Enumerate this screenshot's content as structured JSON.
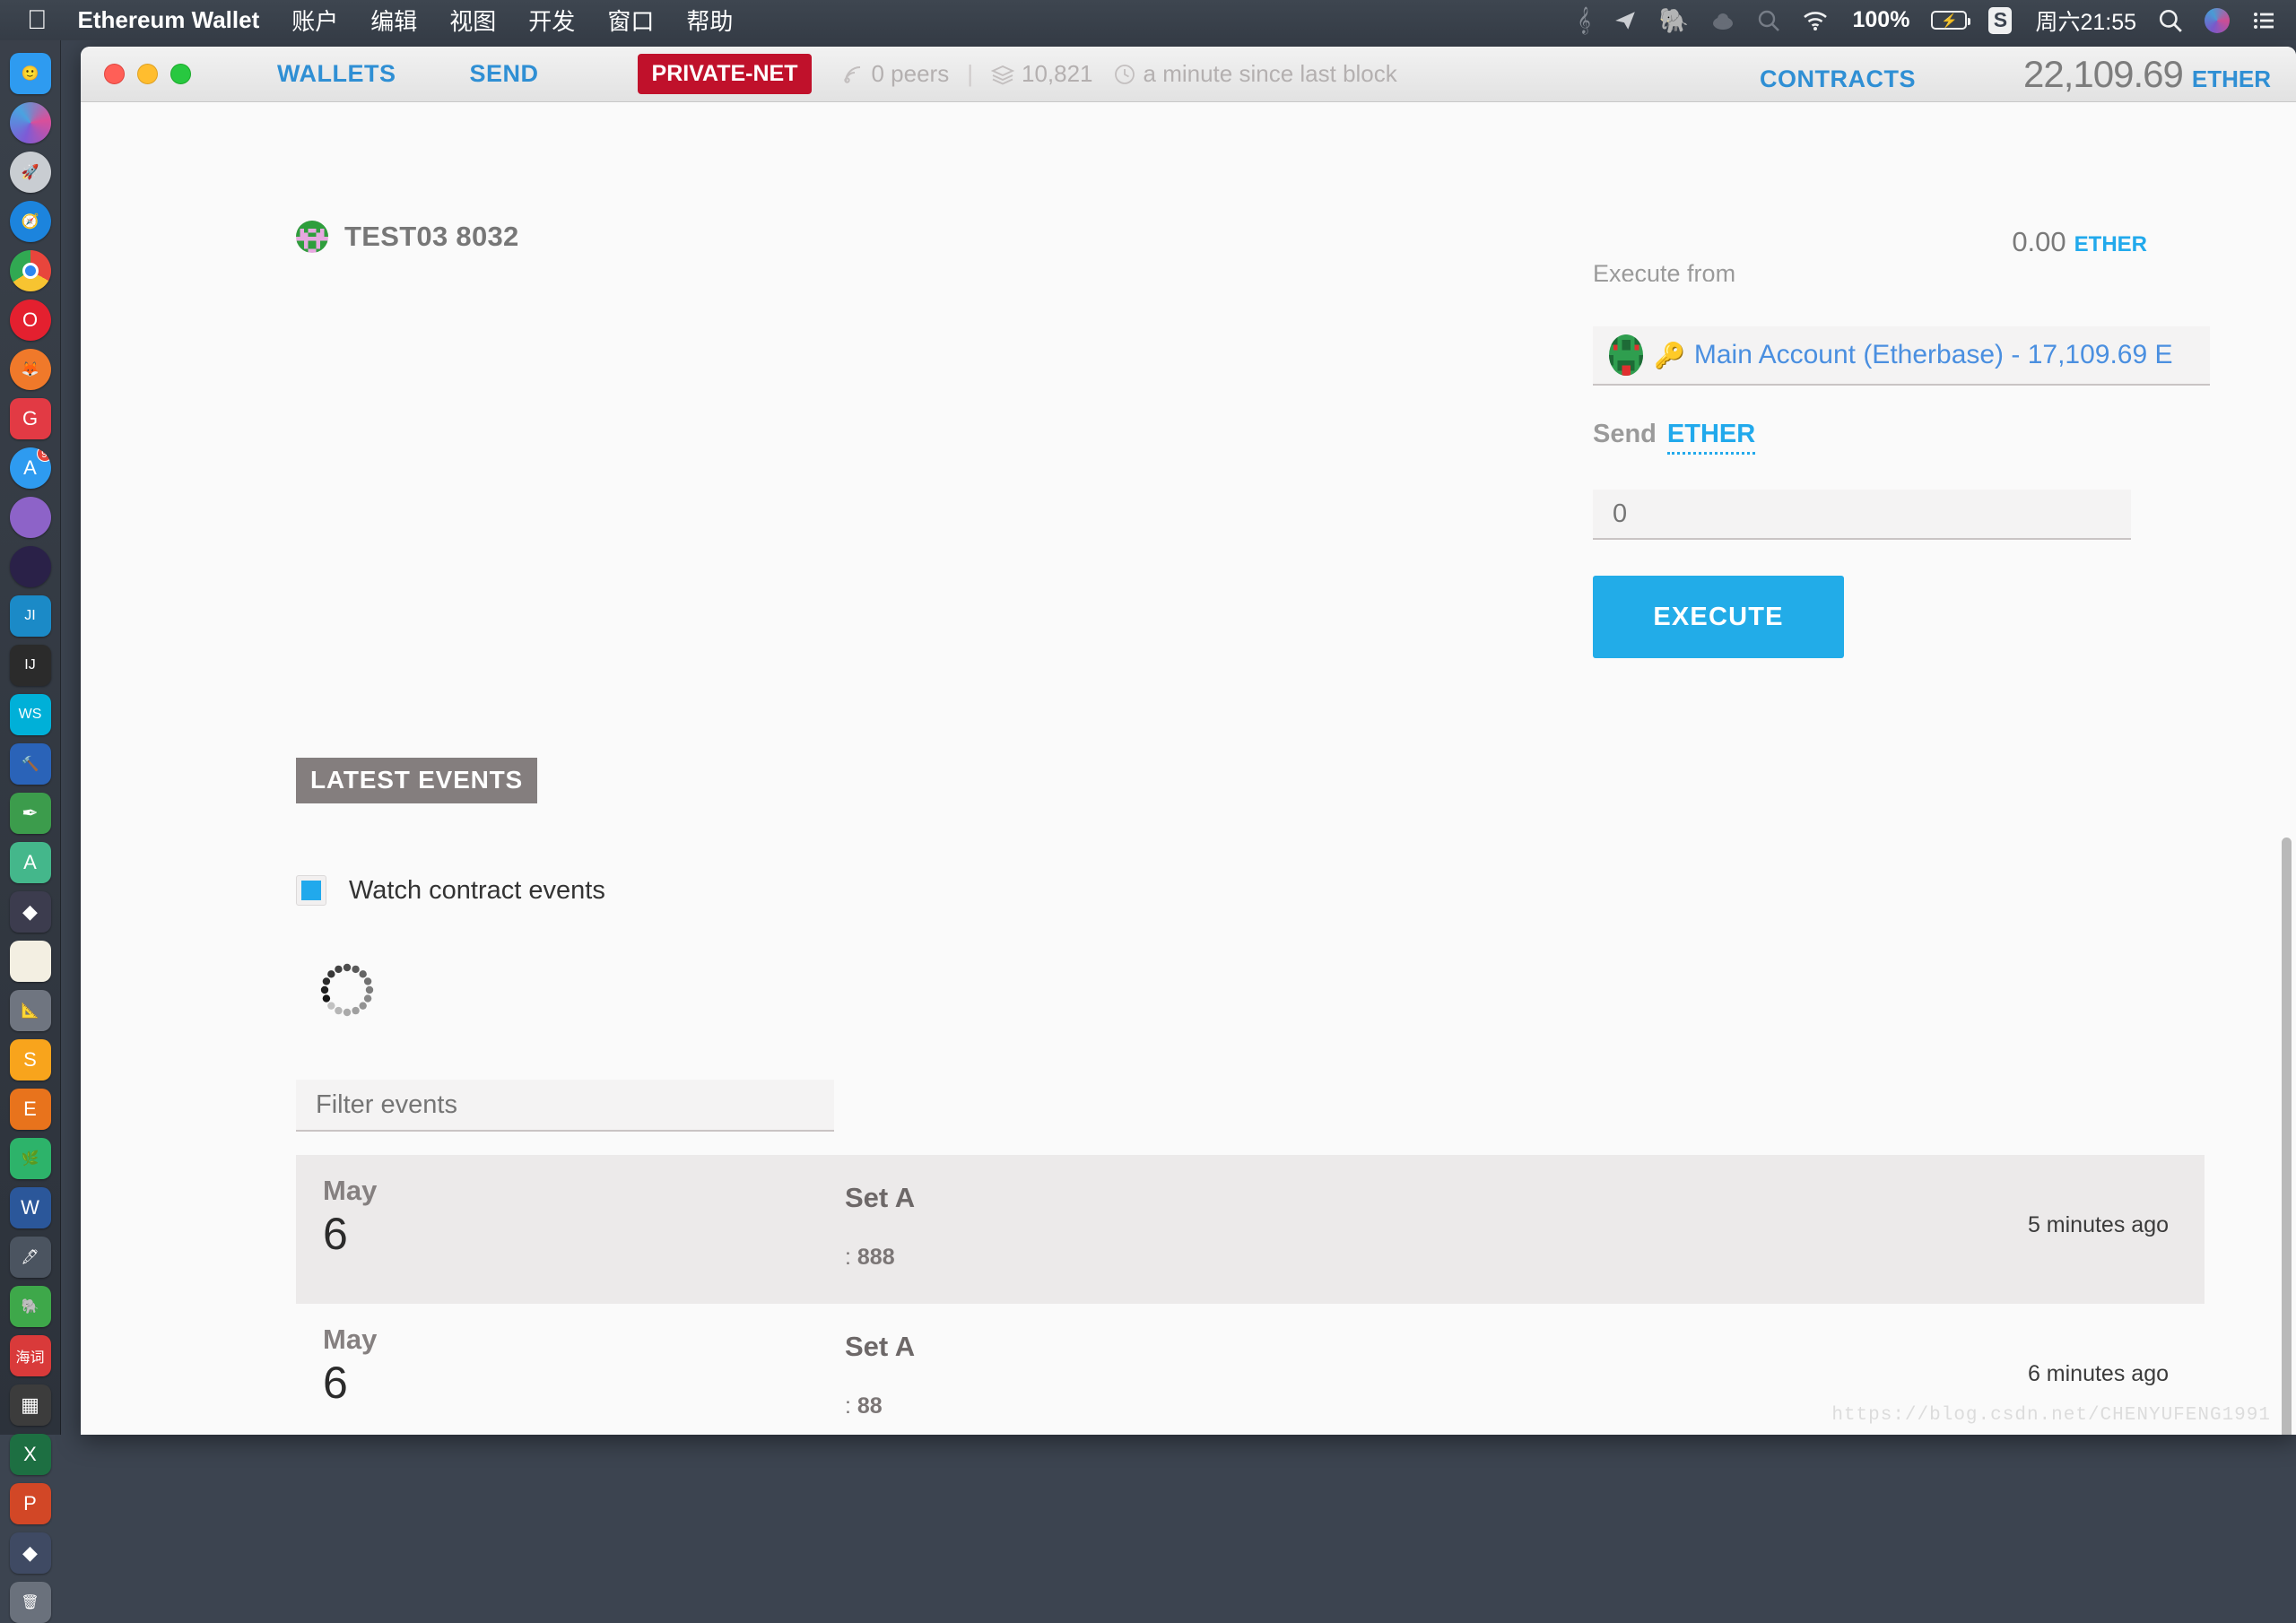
{
  "menubar": {
    "apple_icon": "apple-icon",
    "items": [
      {
        "label": "Ethereum Wallet",
        "bold": true
      },
      {
        "label": "账户",
        "bold": false
      },
      {
        "label": "编辑",
        "bold": false
      },
      {
        "label": "视图",
        "bold": false
      },
      {
        "label": "开发",
        "bold": false
      },
      {
        "label": "窗口",
        "bold": false
      },
      {
        "label": "帮助",
        "bold": false
      }
    ],
    "status_icons": [
      "grammarly-icon",
      "telegram-icon",
      "evernote-icon",
      "cloud-icon",
      "alfred-icon",
      "wifi-icon"
    ],
    "battery_percent": "100%",
    "battery_icon": "battery-charging-icon",
    "sogou_icon": "sogou-input-icon",
    "clock": "周六21:55",
    "search_icon": "spotlight-search-icon",
    "siri_icon": "siri-icon",
    "control_center_icon": "notification-center-icon"
  },
  "dock": {
    "items": [
      {
        "name": "finder",
        "glyph": "🙂",
        "bg": "#2e9bf0",
        "running": true,
        "round": false
      },
      {
        "name": "siri",
        "glyph": "",
        "bg": "siri",
        "running": false,
        "round": true
      },
      {
        "name": "launchpad",
        "glyph": "🚀",
        "bg": "#c9cdd2",
        "running": false,
        "round": true
      },
      {
        "name": "safari",
        "glyph": "🧭",
        "bg": "#1c84dd",
        "running": false,
        "round": true
      },
      {
        "name": "chrome",
        "glyph": "",
        "bg": "chrome",
        "running": true,
        "round": true
      },
      {
        "name": "opera",
        "glyph": "O",
        "bg": "#e4202f",
        "running": false,
        "round": true
      },
      {
        "name": "firefox",
        "glyph": "🦊",
        "bg": "#f0792a",
        "running": false,
        "round": true
      },
      {
        "name": "gitkraken",
        "glyph": "G",
        "bg": "#e23a44",
        "running": true,
        "round": false
      },
      {
        "name": "app-store",
        "glyph": "A",
        "bg": "#2e9bf0",
        "running": false,
        "round": true,
        "badge": "9"
      },
      {
        "name": "terminal-hyper",
        "glyph": "",
        "bg": "#8d63c8",
        "running": false,
        "round": true
      },
      {
        "name": "iterm",
        "glyph": "",
        "bg": "#2a2148",
        "running": false,
        "round": true
      },
      {
        "name": "jetbrains-toolbox",
        "glyph": "JI",
        "bg": "#1b8ac7",
        "running": false,
        "round": false
      },
      {
        "name": "intellij-idea",
        "glyph": "IJ",
        "bg": "#2b2b2b",
        "running": false,
        "round": false
      },
      {
        "name": "webstorm",
        "glyph": "WS",
        "bg": "#00b0d8",
        "running": false,
        "round": false
      },
      {
        "name": "xcode",
        "glyph": "🔨",
        "bg": "#2a63b8",
        "running": false,
        "round": false
      },
      {
        "name": "sublime-text",
        "glyph": "✒",
        "bg": "#3c9c4c",
        "running": false,
        "round": false
      },
      {
        "name": "android-studio",
        "glyph": "A",
        "bg": "#44b78b",
        "running": false,
        "round": false
      },
      {
        "name": "ethereum-mist",
        "glyph": "◆",
        "bg": "#3c3c4e",
        "running": false,
        "round": false
      },
      {
        "name": "notes",
        "glyph": "",
        "bg": "#f3efe2",
        "running": false,
        "round": false
      },
      {
        "name": "ruler-tool",
        "glyph": "📐",
        "bg": "#6f7580",
        "running": false,
        "round": false
      },
      {
        "name": "sketch",
        "glyph": "S",
        "bg": "#f8a41c",
        "running": false,
        "round": false
      },
      {
        "name": "image-editor",
        "glyph": "E",
        "bg": "#e8731c",
        "running": false,
        "round": false
      },
      {
        "name": "sourcetree",
        "glyph": "🌿",
        "bg": "#2db36a",
        "running": false,
        "round": false
      },
      {
        "name": "word",
        "glyph": "W",
        "bg": "#2b579a",
        "running": false,
        "round": false
      },
      {
        "name": "quiver",
        "glyph": "🖋",
        "bg": "#4b5460",
        "running": false,
        "round": false
      },
      {
        "name": "evernote",
        "glyph": "🐘",
        "bg": "#3ea84a",
        "running": false,
        "round": false
      },
      {
        "name": "youdao-dict",
        "glyph": "海词",
        "bg": "#d93a3a",
        "running": false,
        "round": false
      },
      {
        "name": "numbers",
        "glyph": "▦",
        "bg": "#3c3c3c",
        "running": false,
        "round": false
      },
      {
        "name": "excel",
        "glyph": "X",
        "bg": "#1d6f42",
        "running": false,
        "round": false
      },
      {
        "name": "powerpoint",
        "glyph": "P",
        "bg": "#d24726",
        "running": false,
        "round": false
      },
      {
        "name": "ethereum-wallet",
        "glyph": "◆",
        "bg": "#3f4a63",
        "running": true,
        "round": false
      },
      {
        "name": "trash",
        "glyph": "🗑",
        "bg": "#6a717c",
        "running": false,
        "round": false
      }
    ]
  },
  "window": {
    "traffic_lights": [
      "close-button",
      "minimize-button",
      "zoom-button"
    ],
    "nav": [
      {
        "label": "WALLETS",
        "name": "nav-wallets"
      },
      {
        "label": "SEND",
        "name": "nav-send"
      }
    ],
    "network_badge": "PRIVATE-NET",
    "status": {
      "peers": "0 peers",
      "peers_icon": "signal-icon",
      "divider": "|",
      "blocks": "10,821",
      "blocks_icon": "blocks-icon",
      "last_block": "a minute since last block",
      "clock_icon": "clock-icon"
    },
    "contracts_link": "CONTRACTS",
    "balance_value": "22,109.69",
    "balance_unit": "ETHER"
  },
  "contract": {
    "title": "TEST03 8032",
    "identicon": "contract-identicon",
    "balance_value": "0.00",
    "balance_unit": "ETHER"
  },
  "execute_panel": {
    "execute_from_label": "Execute from",
    "account": {
      "identicon": "account-identicon",
      "key_icon": "key-icon",
      "label": "Main Account (Etherbase) - 17,109.69 E"
    },
    "send_label": "Send",
    "send_unit": "ETHER",
    "amount_placeholder": "0",
    "amount_value": "",
    "execute_button": "EXECUTE"
  },
  "events_section": {
    "title": "LATEST EVENTS",
    "watch_checkbox_label": "Watch contract events",
    "watch_checked": true,
    "spinner": "loading-spinner",
    "filter_placeholder": "Filter events",
    "filter_value": "",
    "rows": [
      {
        "month": "May",
        "day": "6",
        "name": "Set A",
        "args_prefix": ": ",
        "args_value": "888",
        "time": "5 minutes ago"
      },
      {
        "month": "May",
        "day": "6",
        "name": "Set A",
        "args_prefix": ": ",
        "args_value": "88",
        "time": "6 minutes ago"
      }
    ]
  },
  "watermark": "https://blog.csdn.net/CHENYUFENG1991",
  "colors": {
    "accent_blue": "#21a9ec",
    "link_blue": "#2f8fd4",
    "network_red": "#c0112b",
    "section_gray": "#847e7e"
  }
}
